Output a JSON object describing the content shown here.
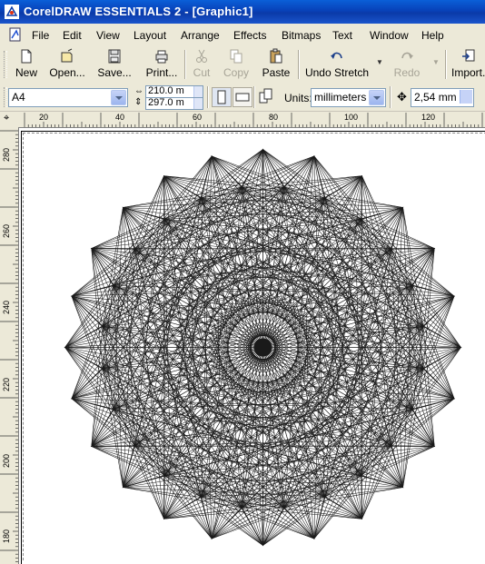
{
  "window": {
    "title": "CorelDRAW ESSENTIALS 2 - [Graphic1]"
  },
  "menu": [
    {
      "label": "File",
      "mn": "F"
    },
    {
      "label": "Edit",
      "mn": "E"
    },
    {
      "label": "View",
      "mn": "V"
    },
    {
      "label": "Layout",
      "mn": "L"
    },
    {
      "label": "Arrange",
      "mn": "A"
    },
    {
      "label": "Effects",
      "mn": "c"
    },
    {
      "label": "Bitmaps",
      "mn": "B"
    },
    {
      "label": "Text",
      "mn": "T"
    },
    {
      "label": "Window",
      "mn": "W"
    },
    {
      "label": "Help",
      "mn": "H"
    }
  ],
  "toolbar": {
    "new_label": "New",
    "open_label": "Open...",
    "save_label": "Save...",
    "print_label": "Print...",
    "cut_label": "Cut",
    "copy_label": "Copy",
    "paste_label": "Paste",
    "undo_label": "Undo Stretch",
    "redo_label": "Redo",
    "import_label": "Import..."
  },
  "property_bar": {
    "page_size": "A4",
    "width": "210.0 m",
    "height": "297.0 m",
    "units_label": "Units:",
    "units_value": "millimeters",
    "nudge_value": "2,54 mm"
  },
  "rulers": {
    "top_labels": [
      "20",
      "40",
      "60",
      "80",
      "100",
      "120"
    ],
    "left_labels": [
      "280",
      "260",
      "240",
      "220",
      "200",
      "180"
    ]
  },
  "colors": {
    "title_bar": "#0a3aa8",
    "chrome": "#ece9d8",
    "artwork": "#1a1a1a"
  },
  "artwork": {
    "type": "spirograph-mandala",
    "star_points": 24
  }
}
